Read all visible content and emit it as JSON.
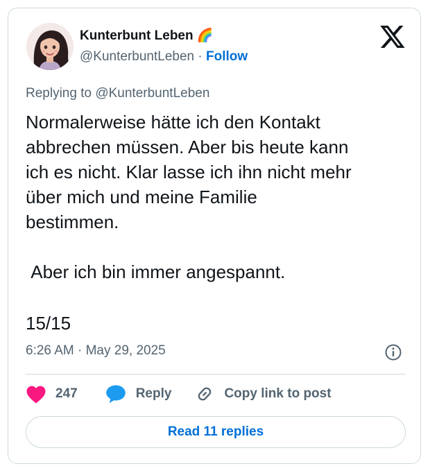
{
  "author": {
    "name": "Kunterbunt Leben 🌈",
    "handle": "@KunterbuntLeben",
    "separator": "·",
    "follow_label": "Follow"
  },
  "platform_icon": "x-logo-icon",
  "reply_to": "Replying to @KunterbuntLeben",
  "tweet": {
    "text": "Normalerweise hätte ich den Kontakt\nabbrechen müssen. Aber bis heute kann\nich es nicht. Klar lasse ich ihn nicht mehr\nüber mich und meine Familie\nbestimmen.\n\n Aber ich bin immer angespannt.",
    "counter": "15/15",
    "timestamp": "6:26 AM · May 29, 2025"
  },
  "actions": {
    "like_count": "247",
    "like_icon": "heart-icon",
    "reply_label": "Reply",
    "reply_icon": "speech-bubble-icon",
    "copy_label": "Copy link to post",
    "copy_icon": "link-icon",
    "info_icon": "info-icon"
  },
  "read_replies_label": "Read 11 replies",
  "colors": {
    "accent": "#006fd6",
    "like": "#f91880",
    "reply": "#1d9bf0",
    "text": "#0f1419",
    "muted": "#536471",
    "border": "#cfd9de"
  }
}
